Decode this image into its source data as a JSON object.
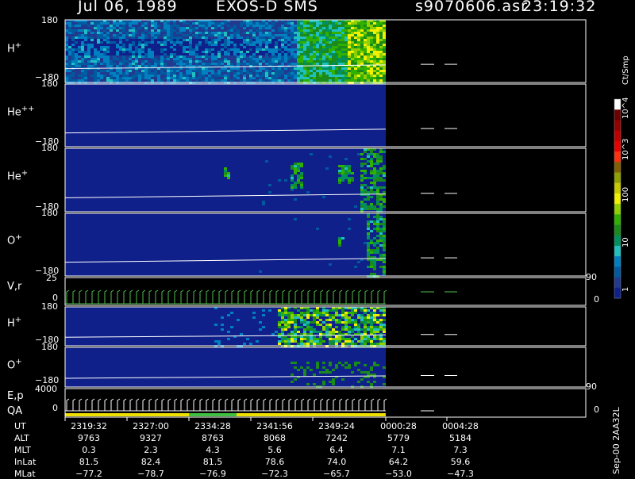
{
  "header": {
    "date": "Jul 06, 1989",
    "instrument": "EXOS-D SMS",
    "filename": "s9070606.asr",
    "time": "23:19:32"
  },
  "panels": [
    {
      "name": "H",
      "sup": "+",
      "ymax": "180",
      "ymin": "−180"
    },
    {
      "name": "He",
      "sup": "++",
      "ymax": "180",
      "ymin": "−180"
    },
    {
      "name": "He",
      "sup": "+",
      "ymax": "180",
      "ymin": "−180"
    },
    {
      "name": "O",
      "sup": "+",
      "ymax": "180",
      "ymin": "−180"
    },
    {
      "name": "V,r",
      "sup": "",
      "ymax": "25",
      "ymin": "0",
      "rmax": "90",
      "rmin": "0"
    },
    {
      "name": "H",
      "sup": "+",
      "ymax": "180",
      "ymin": "−180"
    },
    {
      "name": "O",
      "sup": "+",
      "ymax": "180",
      "ymin": "−180",
      "rmax": "90"
    },
    {
      "name": "E,p",
      "name2": "QA",
      "sup": "",
      "ymax": "4000",
      "ymin": "0",
      "rmin": "0"
    }
  ],
  "colorbar": {
    "unit": "Ct/Smp",
    "ticks": [
      "10^4",
      "10^3",
      "100",
      "10",
      "1"
    ],
    "colors": [
      "#ffffff",
      "#6a0000",
      "#950000",
      "#c00000",
      "#e80000",
      "#ff3010",
      "#806000",
      "#90a000",
      "#c8c800",
      "#f0f000",
      "#90d000",
      "#30b000",
      "#1a8a1a",
      "#009060",
      "#20c0c0",
      "#0080c0",
      "#005aa0",
      "#203a90",
      "#10208a"
    ]
  },
  "orbit": {
    "labels": [
      "UT",
      "ALT",
      "MLT",
      "InLat",
      "MLat"
    ],
    "columns": [
      [
        "2319:32",
        "9763",
        "0.3",
        "81.5",
        "−77.2"
      ],
      [
        "2327:00",
        "9327",
        "2.3",
        "82.4",
        "−78.7"
      ],
      [
        "2334:28",
        "8763",
        "4.3",
        "81.5",
        "−76.9"
      ],
      [
        "2341:56",
        "8068",
        "5.6",
        "78.6",
        "−72.3"
      ],
      [
        "2349:24",
        "7242",
        "6.4",
        "74.0",
        "−65.7"
      ],
      [
        "0000:28",
        "5779",
        "7.1",
        "64.2",
        "−53.0"
      ],
      [
        "0004:28",
        "5184",
        "7.3",
        "59.6",
        "−47.3"
      ]
    ]
  },
  "footer_note": "Sep-00 2AA32L",
  "chart_data": {
    "type": "heatmap",
    "title": "Jul 06, 1989  EXOS-D SMS",
    "x_ticks": [
      "2319:32",
      "2327:00",
      "2334:28",
      "2341:56",
      "2349:24",
      "0000:28",
      "0004:28"
    ],
    "panels": [
      "H+",
      "He++",
      "He+",
      "O+",
      "V,r",
      "H+",
      "O+",
      "E,p QA"
    ],
    "y_range_pitch": [
      -180,
      180
    ],
    "y_range_v": [
      0,
      25
    ],
    "y_range_e": [
      0,
      4000
    ],
    "color_scale": "log",
    "color_range": [
      1,
      10000
    ],
    "color_unit": "Ct/Smp",
    "data_coverage_end": "0000:28"
  }
}
